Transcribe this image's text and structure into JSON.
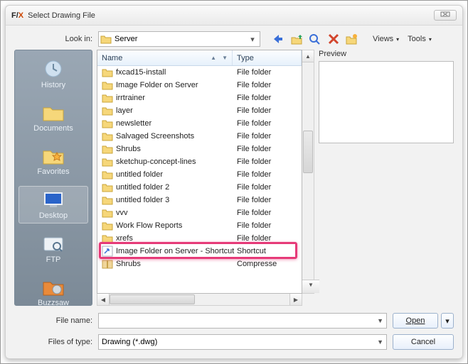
{
  "window": {
    "title": "Select Drawing File",
    "close_icon_label": "✕"
  },
  "lookin": {
    "label": "Look in:",
    "value": "Server"
  },
  "toolbar": {
    "views": "Views",
    "tools": "Tools"
  },
  "places": [
    {
      "key": "history",
      "label": "History"
    },
    {
      "key": "documents",
      "label": "Documents"
    },
    {
      "key": "favorites",
      "label": "Favorites"
    },
    {
      "key": "desktop",
      "label": "Desktop"
    },
    {
      "key": "ftp",
      "label": "FTP"
    },
    {
      "key": "buzzsaw",
      "label": "Buzzsaw"
    }
  ],
  "columns": {
    "name": "Name",
    "type": "Type"
  },
  "rows": [
    {
      "icon": "folder",
      "name": "fxcad15-install",
      "type": "File folder"
    },
    {
      "icon": "folder",
      "name": "Image Folder on Server",
      "type": "File folder"
    },
    {
      "icon": "folder",
      "name": "irrtrainer",
      "type": "File folder"
    },
    {
      "icon": "folder",
      "name": "layer",
      "type": "File folder"
    },
    {
      "icon": "folder",
      "name": "newsletter",
      "type": "File folder"
    },
    {
      "icon": "folder",
      "name": "Salvaged Screenshots",
      "type": "File folder"
    },
    {
      "icon": "folder",
      "name": "Shrubs",
      "type": "File folder"
    },
    {
      "icon": "folder",
      "name": "sketchup-concept-lines",
      "type": "File folder"
    },
    {
      "icon": "folder",
      "name": "untitled folder",
      "type": "File folder"
    },
    {
      "icon": "folder",
      "name": "untitled folder 2",
      "type": "File folder"
    },
    {
      "icon": "folder",
      "name": "untitled folder 3",
      "type": "File folder"
    },
    {
      "icon": "folder",
      "name": "vvv",
      "type": "File folder"
    },
    {
      "icon": "folder",
      "name": "Work Flow Reports",
      "type": "File folder"
    },
    {
      "icon": "folder",
      "name": "xrefs",
      "type": "File folder"
    },
    {
      "icon": "shortcut",
      "name": "Image Folder on Server - Shortcut",
      "type": "Shortcut"
    },
    {
      "icon": "archive",
      "name": "Shrubs",
      "type": "Compresse"
    }
  ],
  "highlight_row_index": 14,
  "preview": {
    "label": "Preview"
  },
  "filename": {
    "label": "File name:",
    "value": ""
  },
  "filetype": {
    "label": "Files of type:",
    "value": "Drawing (*.dwg)"
  },
  "buttons": {
    "open": "Open",
    "cancel": "Cancel"
  },
  "icons": {
    "back": "back-arrow-icon",
    "up": "up-level-icon",
    "search": "search-icon",
    "delete": "delete-icon",
    "newfolder": "new-folder-icon"
  }
}
